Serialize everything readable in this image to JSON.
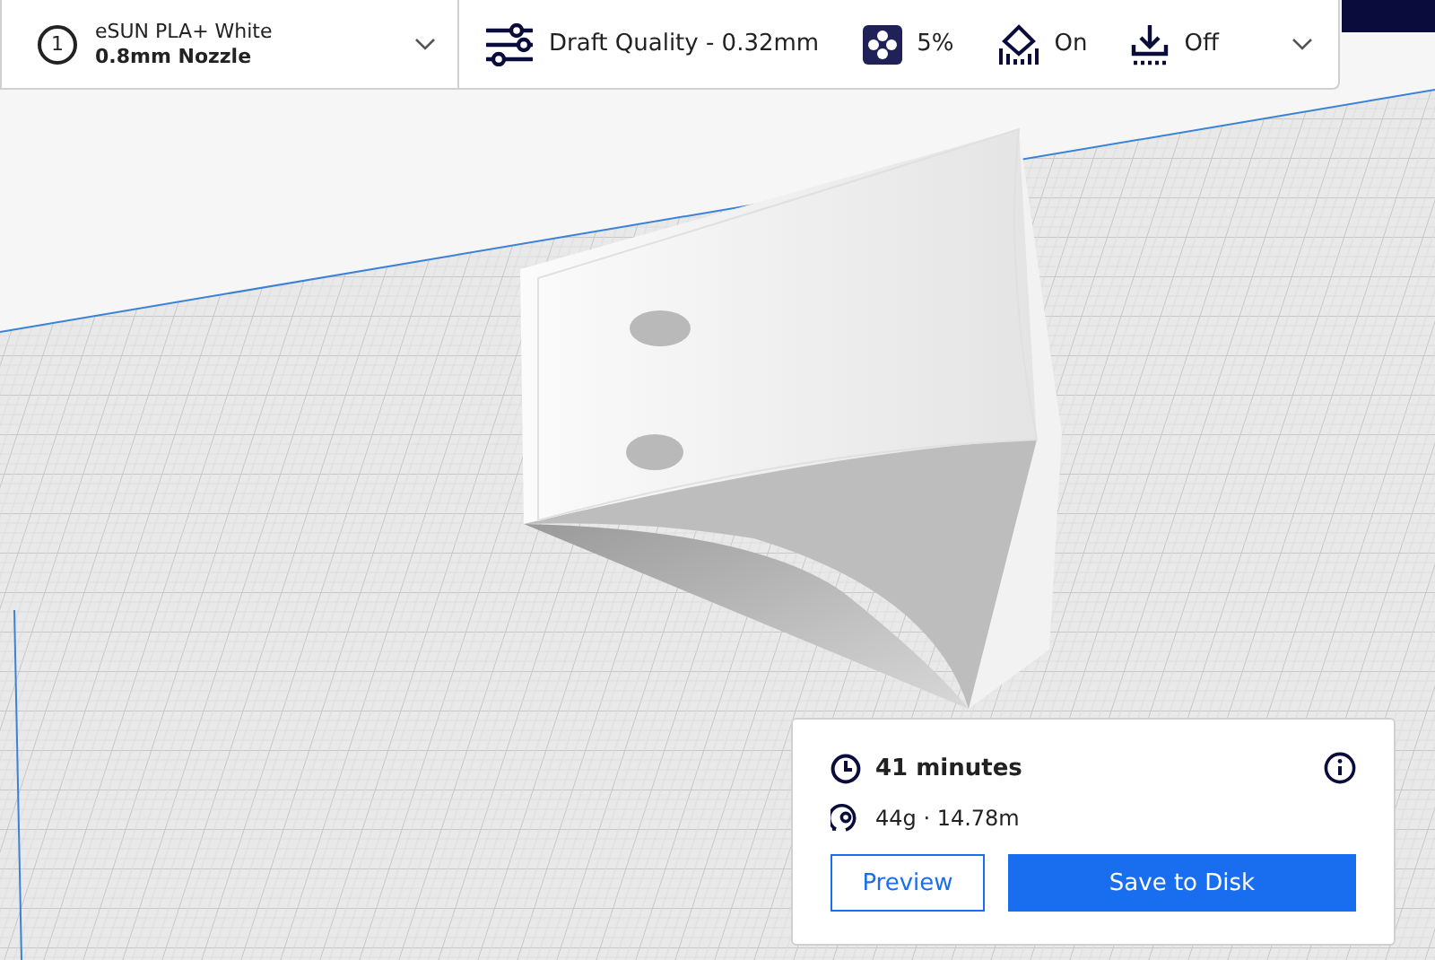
{
  "printer_setup": {
    "extruder_number": "1",
    "material": "eSUN PLA+ White",
    "nozzle": "0.8mm Nozzle"
  },
  "print_settings": {
    "profile": "Draft Quality - 0.32mm",
    "infill": "5%",
    "support": "On",
    "adhesion": "Off"
  },
  "print_summary": {
    "time": "41 minutes",
    "material_usage": "44g · 14.78m",
    "buttons": [
      {
        "label": "Preview",
        "kind": "secondary"
      },
      {
        "label": "Save to Disk",
        "kind": "primary"
      }
    ]
  }
}
